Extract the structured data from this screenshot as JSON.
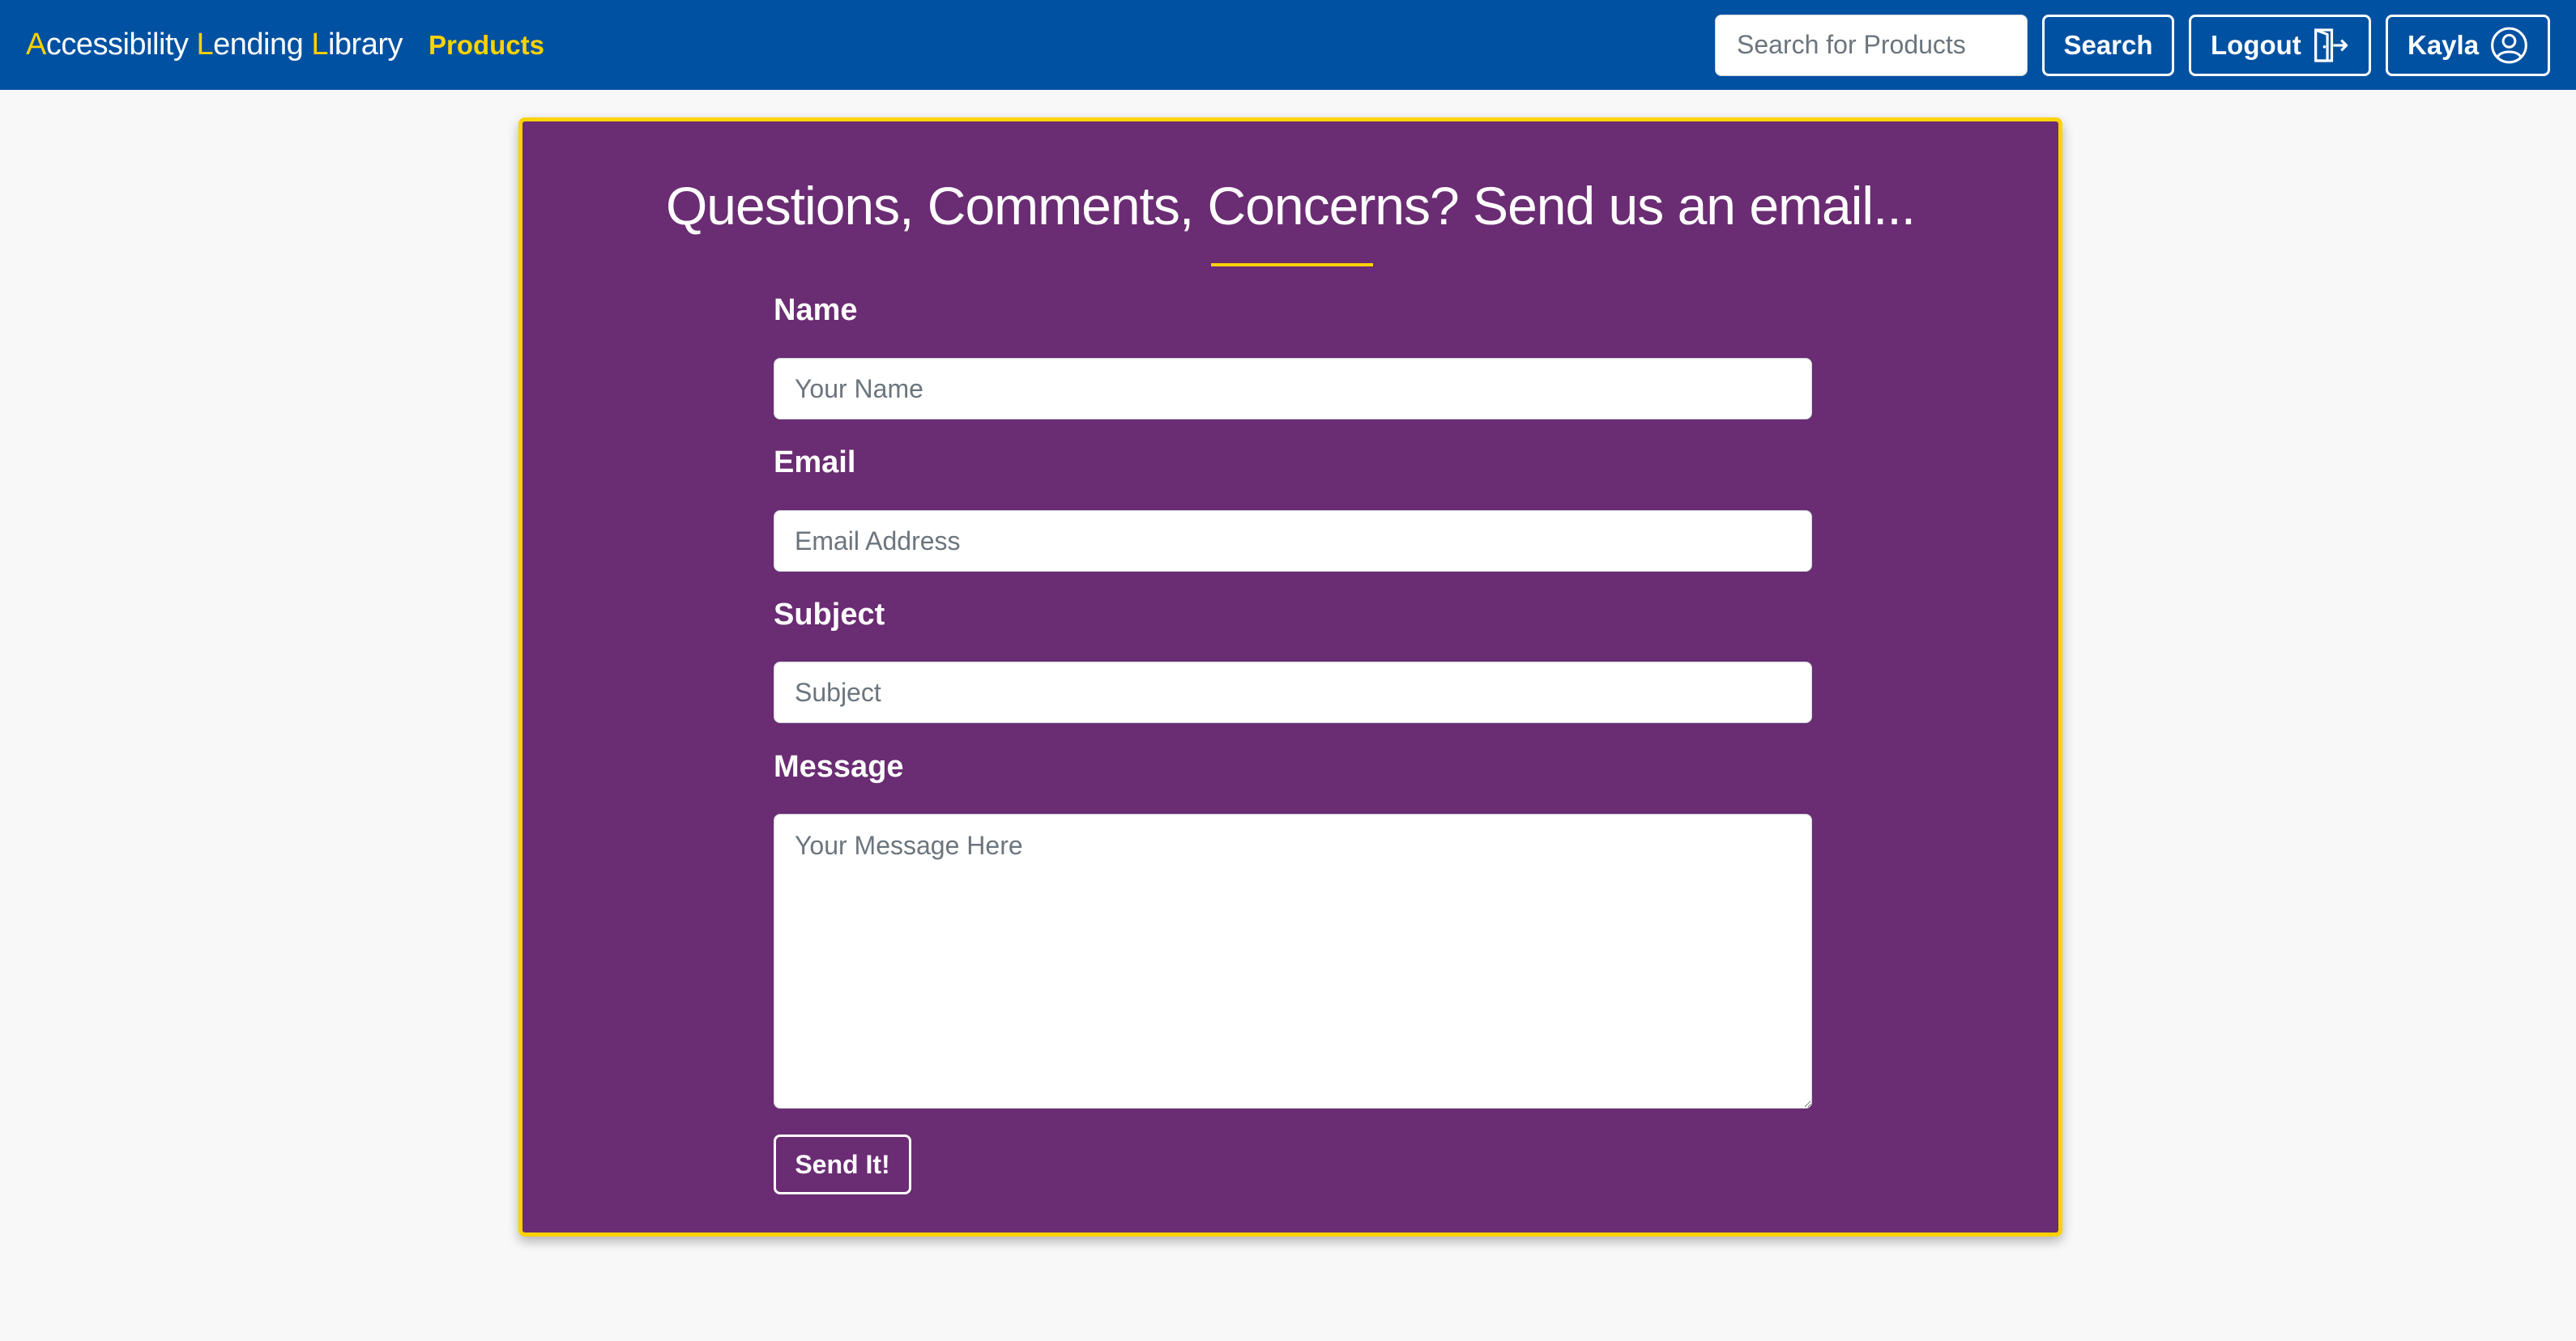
{
  "navbar": {
    "brand": [
      {
        "initial": "A",
        "rest": "ccessibility "
      },
      {
        "initial": "L",
        "rest": "ending "
      },
      {
        "initial": "L",
        "rest": "ibrary"
      }
    ],
    "products_link": "Products",
    "search_placeholder": "Search for Products",
    "search_button": "Search",
    "logout_button": "Logout",
    "user_button": "Kayla",
    "icons": {
      "logout": "door-exit-icon",
      "user": "user-circle-icon"
    }
  },
  "contact_form": {
    "title": "Questions, Comments, Concerns? Send us an email...",
    "name_label": "Name",
    "name_placeholder": "Your Name",
    "email_label": "Email",
    "email_placeholder": "Email Address",
    "subject_label": "Subject",
    "subject_placeholder": "Subject",
    "message_label": "Message",
    "message_placeholder": "Your Message Here",
    "submit_button": "Send It!"
  },
  "colors": {
    "navbar_bg": "#0051a1",
    "accent_yellow": "#ffd200",
    "card_bg": "#6a2c72",
    "page_bg": "#f8f8f8"
  }
}
